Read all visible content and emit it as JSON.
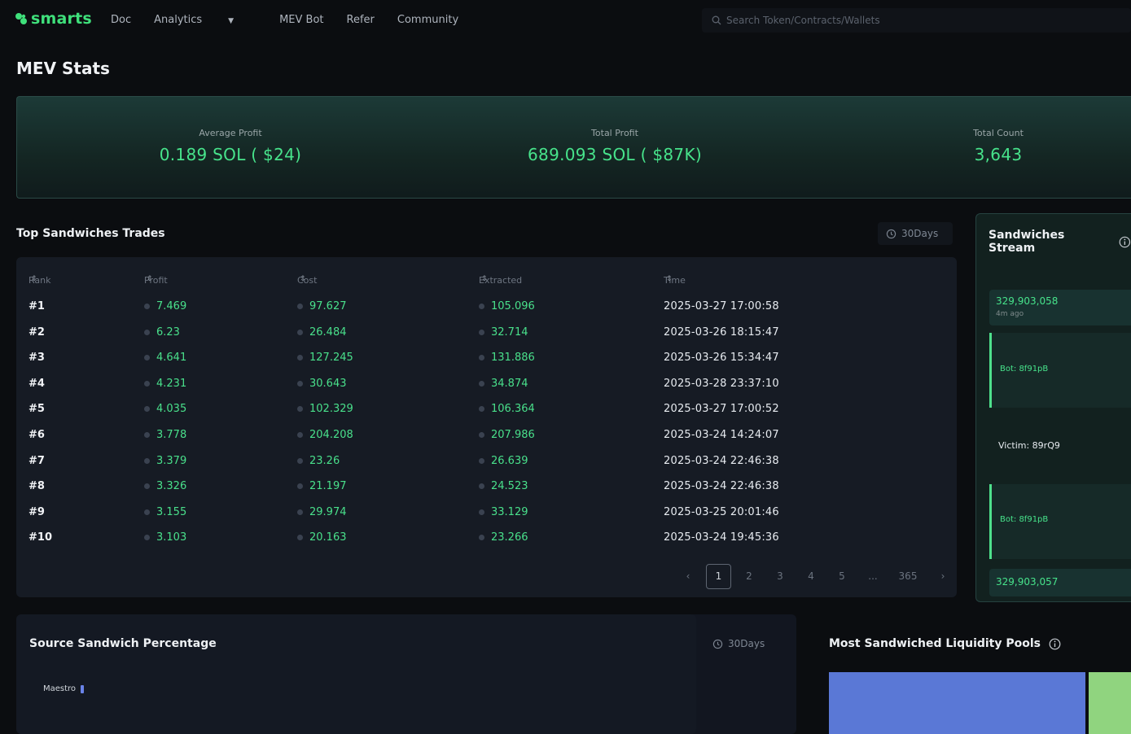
{
  "nav": {
    "logo_text": "smarts",
    "links": [
      "Doc",
      "Analytics",
      "MEV Bot",
      "Refer",
      "Community"
    ],
    "search_placeholder": "Search Token/Contracts/Wallets"
  },
  "page_title": "MEV Stats",
  "stats": {
    "average_profit": {
      "label": "Average Profit",
      "value": "0.189 SOL ( $24)"
    },
    "total_profit": {
      "label": "Total Profit",
      "value": "689.093 SOL ( $87K)"
    },
    "total_count": {
      "label": "Total Count",
      "value": "3,643"
    }
  },
  "top_trades": {
    "title": "Top Sandwiches Trades",
    "range": "30Days",
    "headers": [
      "Rank",
      "Profit",
      "Cost",
      "Extracted",
      "Time"
    ],
    "rows": [
      {
        "rank": "#1",
        "profit": "7.469",
        "cost": "97.627",
        "extracted": "105.096",
        "time": "2025-03-27 17:00:58"
      },
      {
        "rank": "#2",
        "profit": "6.23",
        "cost": "26.484",
        "extracted": "32.714",
        "time": "2025-03-26 18:15:47"
      },
      {
        "rank": "#3",
        "profit": "4.641",
        "cost": "127.245",
        "extracted": "131.886",
        "time": "2025-03-26 15:34:47"
      },
      {
        "rank": "#4",
        "profit": "4.231",
        "cost": "30.643",
        "extracted": "34.874",
        "time": "2025-03-28 23:37:10"
      },
      {
        "rank": "#5",
        "profit": "4.035",
        "cost": "102.329",
        "extracted": "106.364",
        "time": "2025-03-27 17:00:52"
      },
      {
        "rank": "#6",
        "profit": "3.778",
        "cost": "204.208",
        "extracted": "207.986",
        "time": "2025-03-24 14:24:07"
      },
      {
        "rank": "#7",
        "profit": "3.379",
        "cost": "23.26",
        "extracted": "26.639",
        "time": "2025-03-24 22:46:38"
      },
      {
        "rank": "#8",
        "profit": "3.326",
        "cost": "21.197",
        "extracted": "24.523",
        "time": "2025-03-24 22:46:38"
      },
      {
        "rank": "#9",
        "profit": "3.155",
        "cost": "29.974",
        "extracted": "33.129",
        "time": "2025-03-25 20:01:46"
      },
      {
        "rank": "#10",
        "profit": "3.103",
        "cost": "20.163",
        "extracted": "23.266",
        "time": "2025-03-24 19:45:36"
      }
    ],
    "pagination": {
      "prev": "‹",
      "pages": [
        "1",
        "2",
        "3",
        "4",
        "5"
      ],
      "ellipsis": "...",
      "last": "365",
      "next": "›"
    }
  },
  "stream": {
    "title": "Sandwiches Stream",
    "top_slot": {
      "value": "329,903,058",
      "sub": "4m ago"
    },
    "bot_label": "Bot: 8f91pB",
    "victim_label": "Victim: 89rQ9",
    "bottom_slot": {
      "value": "329,903,057"
    }
  },
  "source_pct": {
    "title": "Source Sandwich Percentage",
    "range": "30Days",
    "legend": [
      "Maestro"
    ]
  },
  "pools": {
    "title": "Most Sandwiched Liquidity Pools"
  },
  "colors": {
    "accent": "#47e38b",
    "pool_a": "#5a78d6",
    "pool_b": "#90d47f"
  }
}
